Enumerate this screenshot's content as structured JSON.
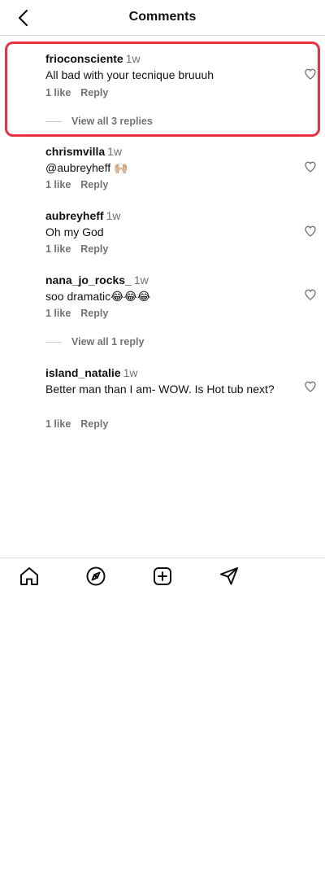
{
  "header": {
    "title": "Comments",
    "back_icon": "chevron-left-icon"
  },
  "comments": [
    {
      "username": "frioconsciente",
      "time": "1w",
      "text": "All bad with your tecnique bruuuh",
      "likes": "1 like",
      "reply_label": "Reply",
      "view_replies": "View all 3 replies",
      "highlighted": true
    },
    {
      "username": "chrismvilla",
      "time": "1w",
      "text": "@aubreyheff 🙌🏼",
      "likes": "1 like",
      "reply_label": "Reply"
    },
    {
      "username": "aubreyheff",
      "time": "1w",
      "text": "Oh my God",
      "likes": "1 like",
      "reply_label": "Reply"
    },
    {
      "username": "nana_jo_rocks_",
      "time": "1w",
      "text": "soo dramatic😂😂😂",
      "likes": "1 like",
      "reply_label": "Reply",
      "view_replies": "View all 1 reply"
    },
    {
      "username": "island_natalie",
      "time": "1w",
      "text": "Better man than I am- WOW. Is Hot tub next?",
      "likes": "1 like",
      "reply_label": "Reply"
    }
  ],
  "bottom_nav": {
    "items": [
      "home-icon",
      "explore-icon",
      "create-icon",
      "direct-message-icon"
    ]
  },
  "colors": {
    "highlight_border": "#e8323f",
    "secondary_text": "#737373",
    "divider": "#dbdbdb"
  }
}
